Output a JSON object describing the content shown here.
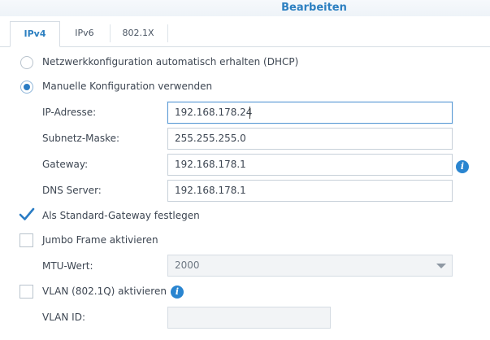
{
  "window": {
    "title": "Bearbeiten"
  },
  "tabs": [
    {
      "label": "IPv4",
      "active": true
    },
    {
      "label": "IPv6",
      "active": false
    },
    {
      "label": "802.1X",
      "active": false
    }
  ],
  "options": {
    "dhcp_label": "Netzwerkkonfiguration automatisch erhalten (DHCP)",
    "dhcp_selected": false,
    "manual_label": "Manuelle Konfiguration verwenden",
    "manual_selected": true
  },
  "fields": {
    "ip": {
      "label": "IP-Adresse:",
      "value": "192.168.178.24"
    },
    "subnet": {
      "label": "Subnetz-Maske:",
      "value": "255.255.255.0"
    },
    "gateway": {
      "label": "Gateway:",
      "value": "192.168.178.1"
    },
    "dns": {
      "label": "DNS Server:",
      "value": "192.168.178.1"
    }
  },
  "checkboxes": {
    "default_gateway": {
      "label": "Als Standard-Gateway festlegen",
      "checked": true
    },
    "jumbo_frame": {
      "label": "Jumbo Frame aktivieren",
      "checked": false
    },
    "vlan": {
      "label": "VLAN (802.1Q) aktivieren",
      "checked": false
    }
  },
  "mtu": {
    "label": "MTU-Wert:",
    "value": "2000",
    "disabled": true
  },
  "vlan_id": {
    "label": "VLAN ID:",
    "value": "",
    "disabled": true
  },
  "colors": {
    "accent": "#2a7cc4",
    "title": "#2d80c1",
    "info": "#2a85d0"
  },
  "icons": {
    "info": "info-icon",
    "checkmark": "checkmark-icon",
    "dropdown": "chevron-down-icon"
  }
}
